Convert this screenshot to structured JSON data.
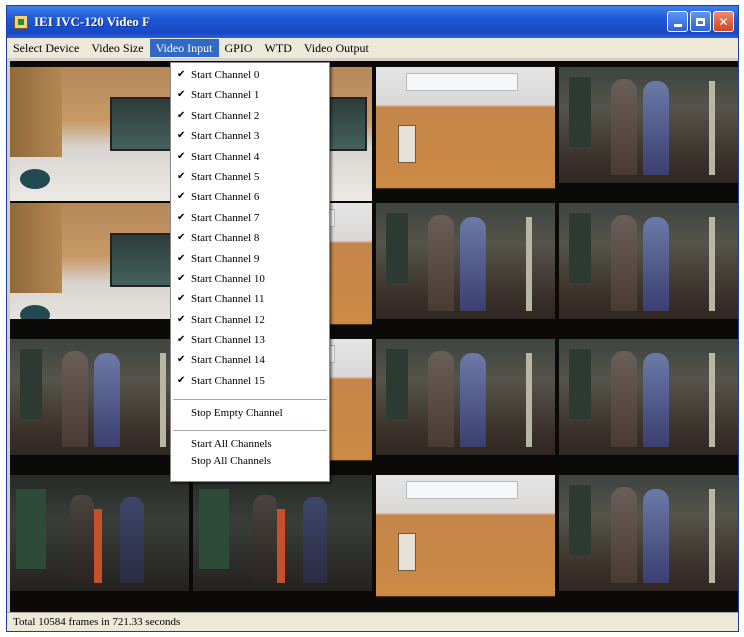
{
  "window": {
    "title": "IEI IVC-120 Video F"
  },
  "menubar": {
    "items": [
      "Select Device",
      "Video Size",
      "Video Input",
      "GPIO",
      "WTD",
      "Video Output"
    ]
  },
  "dropdown": {
    "channels": [
      "Start Channel 0",
      "Start Channel 1",
      "Start Channel 2",
      "Start Channel 3",
      "Start Channel 4",
      "Start Channel 5",
      "Start Channel 6",
      "Start Channel 7",
      "Start Channel 8",
      "Start Channel 9",
      "Start Channel 10",
      "Start Channel 11",
      "Start Channel 12",
      "Start Channel 13",
      "Start Channel 14",
      "Start Channel 15"
    ],
    "checked": true,
    "stop_empty": "Stop Empty Channel",
    "start_all": "Start All Channels",
    "stop_all": "Stop All Channels"
  },
  "status": {
    "text": "Total 10584 frames in 721.33 seconds"
  }
}
